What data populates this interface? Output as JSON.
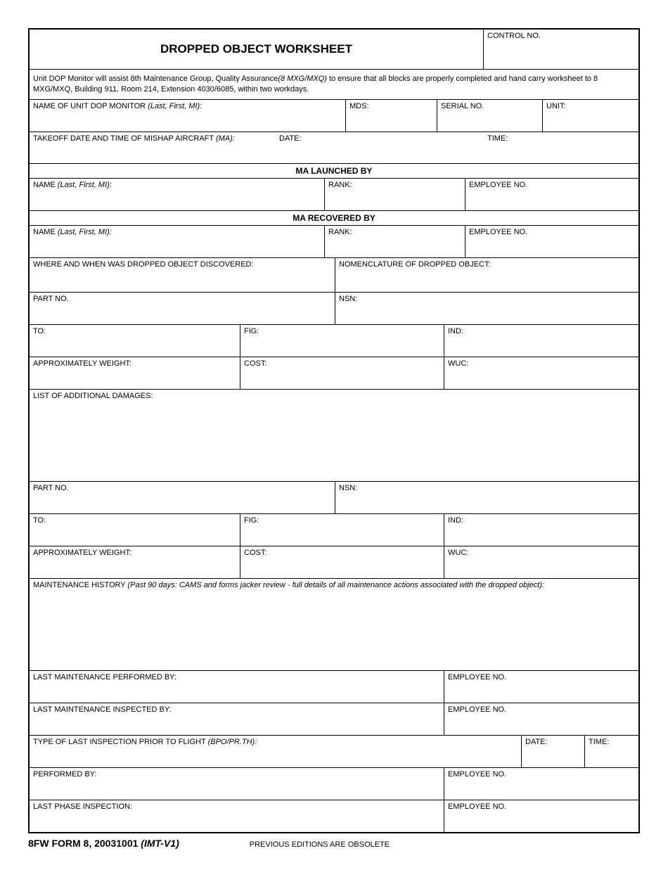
{
  "header": {
    "title": "DROPPED OBJECT WORKSHEET",
    "control_label": "CONTROL NO."
  },
  "instruction": {
    "text_a": "Unit DOP Monitor will assist 8th Maintenance Group, Quality Assurance",
    "text_b": "(8 MXG/MXQ)",
    "text_c": " to ensure that all blocks are properly completed and hand carry worksheet to 8 MXG/MXQ, Building 911, Room 214, Extension 4030/6085, within two workdays."
  },
  "fields": {
    "monitor": {
      "label": "NAME OF UNIT DOP MONITOR ",
      "italic": "(Last, First, MI):"
    },
    "mds": "MDS:",
    "serial": "SERIAL NO.",
    "unit": "UNIT:",
    "takeoff": {
      "label": "TAKEOFF DATE AND TIME OF MISHAP AIRCRAFT ",
      "italic": "(MA):"
    },
    "date": "DATE:",
    "time": "TIME:",
    "launched_header": "MA LAUNCHED BY",
    "name": {
      "label": "NAME ",
      "italic": "(Last, First, MI):"
    },
    "rank": "RANK:",
    "employee": "EMPLOYEE NO.",
    "recovered_header": "MA RECOVERED BY",
    "where_when": "WHERE AND WHEN WAS DROPPED OBJECT DISCOVERED:",
    "nomenclature": "NOMENCLATURE OF DROPPED OBJECT:",
    "part_no": "PART NO.",
    "nsn": "NSN:",
    "to": "TO:",
    "fig": "FIG:",
    "ind": "IND:",
    "approx_weight": "APPROXIMATELY WEIGHT:",
    "cost": "COST:",
    "wuc": "WUC:",
    "additional_damages": "LIST OF ADDITIONAL DAMAGES:",
    "maint_history": {
      "label": "MAINTENANCE HISTORY ",
      "italic": "(Past 90 days:  CAMS and forms jacker review - full details of all maintenance actions associated with the dropped object):"
    },
    "last_performed": "LAST MAINTENANCE PERFORMED BY:",
    "last_inspected": "LAST MAINTENANCE INSPECTED BY:",
    "type_inspection": {
      "label": "TYPE OF LAST INSPECTION PRIOR TO FLIGHT ",
      "italic": "(BPO/PR.TH):"
    },
    "performed_by": "PERFORMED BY:",
    "last_phase": "LAST PHASE INSPECTION:"
  },
  "footer": {
    "form_a": "8FW FORM 8, 20031001 ",
    "form_b": "(IMT-V1)",
    "note": "PREVIOUS EDITIONS ARE OBSOLETE"
  }
}
